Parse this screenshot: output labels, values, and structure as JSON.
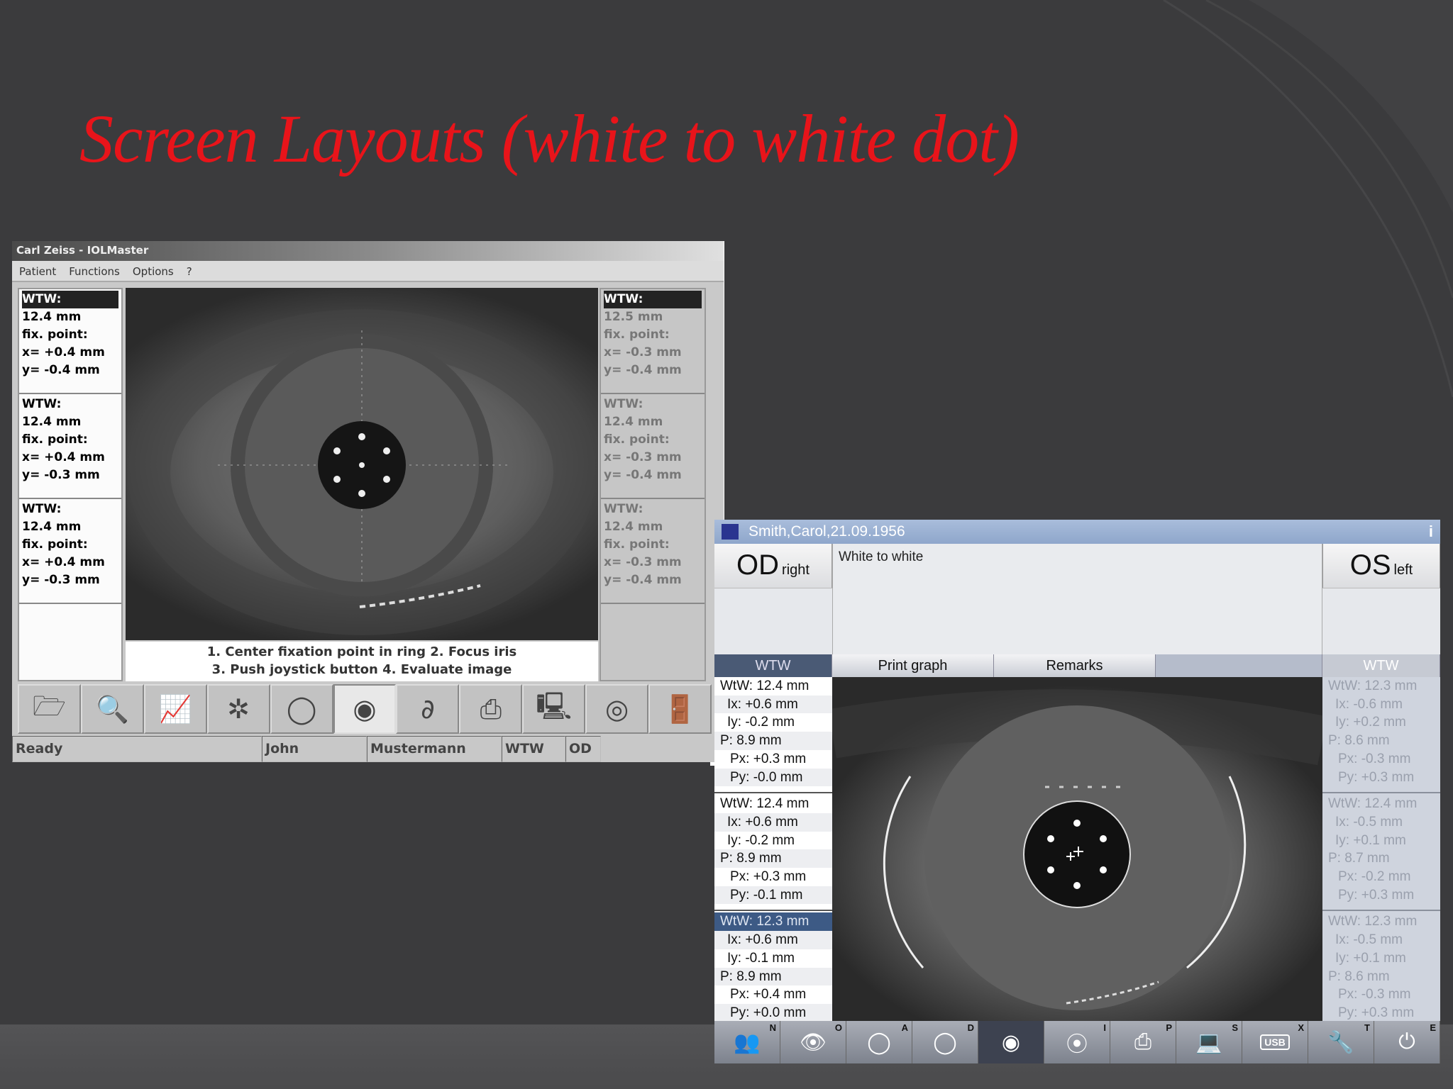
{
  "slide": {
    "title": "Screen Layouts (white to white dot)"
  },
  "old_app": {
    "window_title": "Carl Zeiss - IOLMaster",
    "menu": [
      "Patient",
      "Functions",
      "Options",
      "?"
    ],
    "left_results": [
      {
        "label": "WTW:",
        "value": "12.4 mm",
        "fix": "fix. point:",
        "x": "x= +0.4 mm",
        "y": "y= -0.4 mm"
      },
      {
        "label": "WTW:",
        "value": "12.4 mm",
        "fix": "fix. point:",
        "x": "x= +0.4 mm",
        "y": "y= -0.3 mm"
      },
      {
        "label": "WTW:",
        "value": "12.4 mm",
        "fix": "fix. point:",
        "x": "x= +0.4 mm",
        "y": "y= -0.3 mm"
      }
    ],
    "right_results": [
      {
        "label": "WTW:",
        "value": "12.5 mm",
        "fix": "fix. point:",
        "x": "x= -0.3 mm",
        "y": "y= -0.4 mm"
      },
      {
        "label": "WTW:",
        "value": "12.4 mm",
        "fix": "fix. point:",
        "x": "x= -0.3 mm",
        "y": "y= -0.4 mm"
      },
      {
        "label": "WTW:",
        "value": "12.4 mm",
        "fix": "fix. point:",
        "x": "x= -0.3 mm",
        "y": "y= -0.4 mm"
      }
    ],
    "instructions": [
      "1. Center fixation point in ring 2. Focus iris",
      "3. Push joystick button 4. Evaluate image"
    ],
    "toolbar": [
      {
        "icon": "folder-icon",
        "glyph": "🗁"
      },
      {
        "icon": "magnifier-icon",
        "glyph": "🔍"
      },
      {
        "icon": "graph-icon",
        "glyph": "📈"
      },
      {
        "icon": "keratometry-icon",
        "glyph": "✲"
      },
      {
        "icon": "ring-icon",
        "glyph": "◯"
      },
      {
        "icon": "eye-wtw-icon",
        "glyph": "◉"
      },
      {
        "icon": "ac-depth-icon",
        "glyph": "∂"
      },
      {
        "icon": "printer-icon",
        "glyph": "⎙"
      },
      {
        "icon": "computer-icon",
        "glyph": "🖳"
      },
      {
        "icon": "disc-icon",
        "glyph": "◎"
      },
      {
        "icon": "exit-door-icon",
        "glyph": "🚪"
      }
    ],
    "status": {
      "state": "Ready",
      "first_name": "John",
      "last_name": "Mustermann",
      "mode": "WTW",
      "eye": "OD"
    }
  },
  "new_app": {
    "window_title": "Smith,Carol,21.09.1956",
    "logo": "ZEISS",
    "info": "i",
    "od": {
      "big": "OD",
      "small": "right"
    },
    "os": {
      "big": "OS",
      "small": "left"
    },
    "description": "White to white",
    "tabs": {
      "left": "WTW",
      "print": "Print graph",
      "remarks": "Remarks",
      "right": "WTW"
    },
    "left_results": [
      [
        "WtW: 12.4 mm",
        "Ix: +0.6 mm",
        "Iy: -0.2 mm",
        "P: 8.9 mm",
        "Px: +0.3 mm",
        "Py: -0.0 mm"
      ],
      [
        "WtW: 12.4 mm",
        "Ix: +0.6 mm",
        "Iy: -0.2 mm",
        "P: 8.9 mm",
        "Px: +0.3 mm",
        "Py: -0.1 mm"
      ],
      [
        "WtW: 12.3 mm",
        "Ix: +0.6 mm",
        "Iy: -0.1 mm",
        "P: 8.9 mm",
        "Px: +0.4 mm",
        "Py: +0.0 mm"
      ]
    ],
    "right_results": [
      [
        "WtW: 12.3 mm",
        "Ix: -0.6 mm",
        "Iy: +0.2 mm",
        "P: 8.6 mm",
        "Px: -0.3 mm",
        "Py: +0.3 mm"
      ],
      [
        "WtW: 12.4 mm",
        "Ix: -0.5 mm",
        "Iy: +0.1 mm",
        "P: 8.7 mm",
        "Px: -0.2 mm",
        "Py: +0.3 mm"
      ],
      [
        "WtW: 12.3 mm",
        "Ix: -0.5 mm",
        "Iy: +0.1 mm",
        "P: 8.6 mm",
        "Px: -0.3 mm",
        "Py: +0.3 mm"
      ]
    ],
    "toolbar": [
      {
        "icon": "patients-icon",
        "glyph": "👥",
        "key": "N"
      },
      {
        "icon": "eye-overview-icon",
        "glyph": "👁",
        "key": "O"
      },
      {
        "icon": "axial-length-icon",
        "glyph": "◯",
        "key": "A"
      },
      {
        "icon": "ac-depth-icon",
        "glyph": "◯",
        "key": "D"
      },
      {
        "icon": "white-to-white-icon",
        "glyph": "◉",
        "key": ""
      },
      {
        "icon": "iol-icon",
        "glyph": "⦿",
        "key": "I"
      },
      {
        "icon": "printer-icon",
        "glyph": "⎙",
        "key": "P"
      },
      {
        "icon": "laptop-icon",
        "glyph": "💻",
        "key": "S"
      },
      {
        "icon": "usb-icon",
        "glyph": "USB",
        "key": "X"
      },
      {
        "icon": "wrench-icon",
        "glyph": "🔧",
        "key": "T"
      },
      {
        "icon": "power-icon",
        "glyph": "⏻",
        "key": "E"
      }
    ]
  }
}
